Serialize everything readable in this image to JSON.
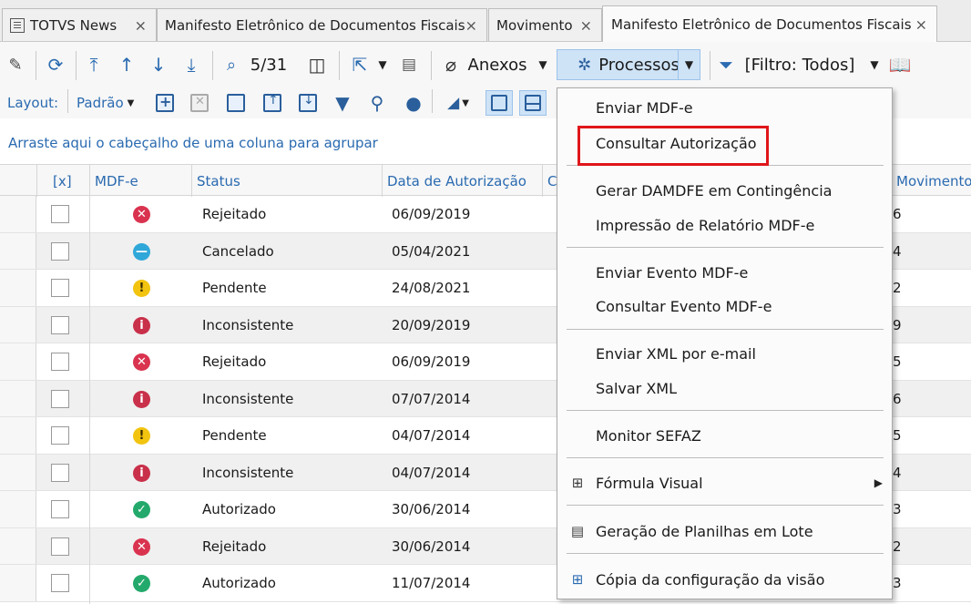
{
  "tabs": [
    {
      "label": "TOTVS News",
      "close": "×"
    },
    {
      "label": "Manifesto Eletrônico de Documentos Fiscais",
      "close": "×"
    },
    {
      "label": "Movimento",
      "close": "×"
    },
    {
      "label": "Manifesto Eletrônico de Documentos Fiscais",
      "close": "×"
    }
  ],
  "toolbar": {
    "record_counter": "5/31",
    "anexos_label": "Anexos",
    "processos_label": "Processos",
    "filter_label": "[Filtro: Todos]"
  },
  "toolbar2": {
    "layout_label": "Layout:",
    "layout_value": "Padrão"
  },
  "group_hint": "Arraste aqui o cabeçalho de uma coluna para agrupar",
  "grid": {
    "headers": {
      "select": "[x]",
      "mdfe": "MDF-e",
      "status": "Status",
      "data_autorizacao": "Data de Autorização",
      "hidden_col": "C",
      "movimento": "Movimento"
    },
    "rows": [
      {
        "status": "Rejeitado",
        "date": "06/09/2019",
        "mov": "6",
        "icon": "rejected-icon",
        "color": "#d9334f",
        "glyph": "✕"
      },
      {
        "status": "Cancelado",
        "date": "05/04/2021",
        "mov": "4",
        "icon": "cancelled-icon",
        "color": "#2fa7d9",
        "glyph": "—"
      },
      {
        "status": "Pendente",
        "date": "24/08/2021",
        "mov": "2",
        "icon": "pending-icon",
        "color": "#f2c40f",
        "glyph": "!"
      },
      {
        "status": "Inconsistente",
        "date": "20/09/2019",
        "mov": "9",
        "icon": "inconsistent-icon",
        "color": "#c9304a",
        "glyph": "i"
      },
      {
        "status": "Rejeitado",
        "date": "06/09/2019",
        "mov": "5",
        "icon": "rejected-icon",
        "color": "#d9334f",
        "glyph": "✕"
      },
      {
        "status": "Inconsistente",
        "date": "07/07/2014",
        "mov": "6",
        "icon": "inconsistent-icon",
        "color": "#c9304a",
        "glyph": "i"
      },
      {
        "status": "Pendente",
        "date": "04/07/2014",
        "mov": "5",
        "icon": "pending-icon",
        "color": "#f2c40f",
        "glyph": "!"
      },
      {
        "status": "Inconsistente",
        "date": "04/07/2014",
        "mov": "4",
        "icon": "inconsistent-icon",
        "color": "#c9304a",
        "glyph": "i"
      },
      {
        "status": "Autorizado",
        "date": "30/06/2014",
        "mov": "3",
        "icon": "authorized-icon",
        "color": "#23a96b",
        "glyph": "✓"
      },
      {
        "status": "Rejeitado",
        "date": "30/06/2014",
        "mov": "2",
        "icon": "rejected-icon",
        "color": "#d9334f",
        "glyph": "✕"
      },
      {
        "status": "Autorizado",
        "date": "11/07/2014",
        "mov": "3",
        "icon": "authorized-icon",
        "color": "#23a96b",
        "glyph": "✓"
      }
    ]
  },
  "menu": {
    "items": [
      {
        "label": "Enviar MDF-e"
      },
      {
        "label": "Consultar Autorização"
      },
      {
        "label": "Gerar DAMDFE em Contingência"
      },
      {
        "label": "Impressão de Relatório MDF-e"
      },
      {
        "label": "Enviar Evento MDF-e"
      },
      {
        "label": "Consultar Evento MDF-e"
      },
      {
        "label": "Enviar XML por e-mail"
      },
      {
        "label": "Salvar XML"
      },
      {
        "label": "Monitor SEFAZ"
      },
      {
        "label": "Fórmula Visual"
      },
      {
        "label": "Geração de Planilhas em Lote"
      },
      {
        "label": "Cópia da configuração da visão"
      }
    ]
  },
  "colors": {
    "accent": "#2a6ab0",
    "highlight": "#e0161b",
    "processos_bg": "#cfe3f7"
  }
}
